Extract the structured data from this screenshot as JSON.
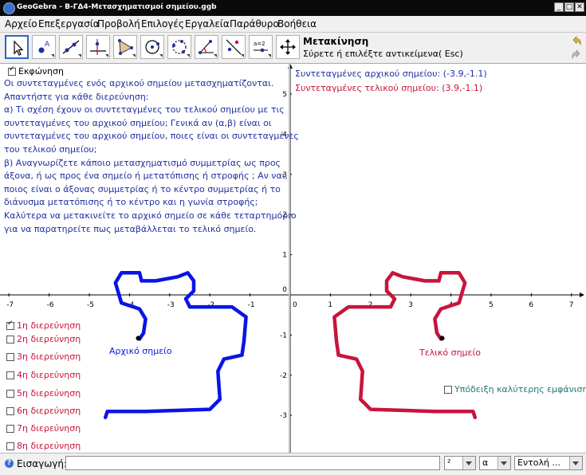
{
  "window": {
    "title": "GeoGebra - Β-ΓΔ4-Μετασχηματισμοί σημείου.ggb",
    "buttons": [
      "_",
      "□",
      "✕"
    ]
  },
  "menu": [
    "Αρχείο",
    "Επεξεργασία",
    "Προβολή",
    "Επιλογές",
    "Εργαλεία",
    "Παράθυρο",
    "Βοήθεια"
  ],
  "toolbar": {
    "tool_name": "Μετακίνηση",
    "tool_help": "Σύρετε ή επιλέξτε αντικείμενα( Esc)",
    "tools": [
      {
        "name": "move-tool-icon",
        "active": true
      },
      {
        "name": "new-point-tool-icon"
      },
      {
        "name": "line-tool-icon"
      },
      {
        "name": "perpendicular-line-tool-icon"
      },
      {
        "name": "polygon-tool-icon"
      },
      {
        "name": "circle-tool-icon"
      },
      {
        "name": "circle-through-points-tool-icon"
      },
      {
        "name": "angle-tool-icon"
      },
      {
        "name": "reflect-tool-icon"
      },
      {
        "name": "slider-tool-icon",
        "label": "a=2"
      },
      {
        "name": "move-view-tool-icon"
      }
    ]
  },
  "algebra": {
    "task_label": "Εκφώνηση",
    "task_text": [
      "Οι συντεταγμένες ενός αρχικού σημείου μετασχηματίζονται.",
      "Απαντήστε για κάθε διερεύνηση:",
      "α) Τι σχέση έχουν οι συντεταγμένες του τελικού σημείου με τις",
      "συντεταγμένες του αρχικού σημείου; Γενικά αν (α,β) είναι οι",
      "συντεταγμένες του αρχικού σημείου, ποιες είναι οι συντεταγμένες",
      "του τελικού σημείου;",
      "β) Αναγνωρίζετε κάποιο μετασχηματισμό συμμετρίας ως προς",
      "άξονα, ή ως προς ένα σημείο ή μετατόπισης ή στροφής ; Αν ναι,",
      "ποιος είναι ο άξονας συμμετρίας ή το κέντρο συμμετρίας ή το",
      "διάνυσμα μετατόπισης ή το κέντρο και η γωνία στροφής;",
      "Καλύτερα να μετακινείτε το αρχικό σημείο σε κάθε τεταρτημόριο",
      "για να παρατηρείτε πως μεταβάλλεται το τελικό σημείο."
    ],
    "inquiries": [
      {
        "label": "1η διερεύνηση",
        "checked": true
      },
      {
        "label": "2η διερεύνηση",
        "checked": false
      },
      {
        "label": "3η διερεύνηση",
        "checked": false
      },
      {
        "label": "4η διερεύνηση",
        "checked": false
      },
      {
        "label": "5η διερεύνηση",
        "checked": false
      },
      {
        "label": "6η διερεύνηση",
        "checked": false
      },
      {
        "label": "7η διερεύνηση",
        "checked": false
      },
      {
        "label": "8η διερεύνηση",
        "checked": false
      }
    ]
  },
  "graphics": {
    "initial_coords_label": "Συντεταγμένες αρχικού σημείου:",
    "initial_coords_value": "(-3.9,-1.1)",
    "final_coords_label": "Συντεταγμένες τελικού σημείου:",
    "final_coords_value": "(3.9,-1.1)",
    "initial_point_label": "Αρχικό σημείο",
    "final_point_label": "Τελικό σημείο",
    "better_view_label": "Υπόδειξη καλύτερης εμφάνισης",
    "x_ticks": [
      "-7",
      "-6",
      "-5",
      "-4",
      "-3",
      "-2",
      "-1",
      "0",
      "1",
      "2",
      "3",
      "4",
      "5",
      "6",
      "7"
    ],
    "y_ticks": [
      "5",
      "4",
      "3",
      "2",
      "1",
      "-1",
      "-2",
      "-3"
    ],
    "colors": {
      "initial": "#0a14e6",
      "final": "#c8143c",
      "axis": "#000000",
      "text_blue": "#1f31a0",
      "teal": "#207878"
    }
  },
  "inputbar": {
    "label": "Εισαγωγή:",
    "value": "",
    "symbol_combo": "²",
    "greek_combo": "α",
    "command_combo": "Εντολή ..."
  }
}
